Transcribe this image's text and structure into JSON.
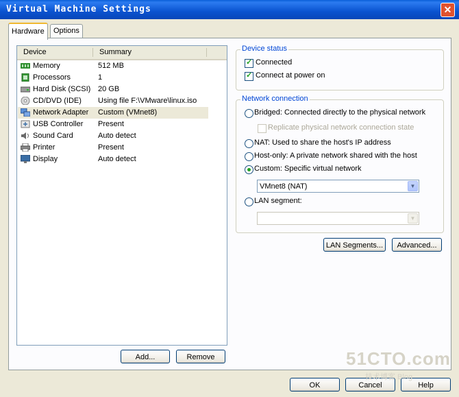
{
  "window": {
    "title": "Virtual Machine Settings",
    "close_glyph": "✕"
  },
  "tabs": [
    {
      "label": "Hardware"
    },
    {
      "label": "Options"
    }
  ],
  "device_list": {
    "headers": {
      "device": "Device",
      "summary": "Summary"
    },
    "rows": [
      {
        "device": "Memory",
        "summary": "512 MB",
        "icon": "memory-icon"
      },
      {
        "device": "Processors",
        "summary": "1",
        "icon": "processor-icon"
      },
      {
        "device": "Hard Disk (SCSI)",
        "summary": "20 GB",
        "icon": "hard-disk-icon"
      },
      {
        "device": "CD/DVD (IDE)",
        "summary": "Using file F:\\VMware\\linux.iso",
        "icon": "cd-dvd-icon"
      },
      {
        "device": "Network Adapter",
        "summary": "Custom (VMnet8)",
        "icon": "network-adapter-icon",
        "selected": true
      },
      {
        "device": "USB Controller",
        "summary": "Present",
        "icon": "usb-controller-icon"
      },
      {
        "device": "Sound Card",
        "summary": "Auto detect",
        "icon": "sound-card-icon"
      },
      {
        "device": "Printer",
        "summary": "Present",
        "icon": "printer-icon"
      },
      {
        "device": "Display",
        "summary": "Auto detect",
        "icon": "display-icon"
      }
    ],
    "add_label": "Add...",
    "remove_label": "Remove"
  },
  "device_status": {
    "title": "Device status",
    "connected": {
      "label": "Connected",
      "checked": true
    },
    "connect_power_on": {
      "label": "Connect at power on",
      "checked": true
    }
  },
  "network_connection": {
    "title": "Network connection",
    "bridged": {
      "label": "Bridged: Connected directly to the physical network",
      "selected": false
    },
    "replicate": {
      "label": "Replicate physical network connection state",
      "checked": false,
      "disabled": true
    },
    "nat": {
      "label": "NAT: Used to share the host's IP address",
      "selected": false
    },
    "host_only": {
      "label": "Host-only: A private network shared with the host",
      "selected": false
    },
    "custom": {
      "label": "Custom: Specific virtual network",
      "selected": true
    },
    "custom_select_value": "VMnet8 (NAT)",
    "lan_segment": {
      "label": "LAN segment:",
      "selected": false
    },
    "lan_select_value": "",
    "lan_segments_btn": "LAN Segments...",
    "advanced_btn": "Advanced..."
  },
  "footer": {
    "ok": "OK",
    "cancel": "Cancel",
    "help": "Help"
  },
  "watermark": {
    "big": "51CTO.com",
    "small": "技术博客  Blog"
  },
  "colors": {
    "title_bar": "#0a53d0",
    "group_title": "#0046d5",
    "check_green": "#21a121",
    "panel_bg": "#ece9d8"
  }
}
